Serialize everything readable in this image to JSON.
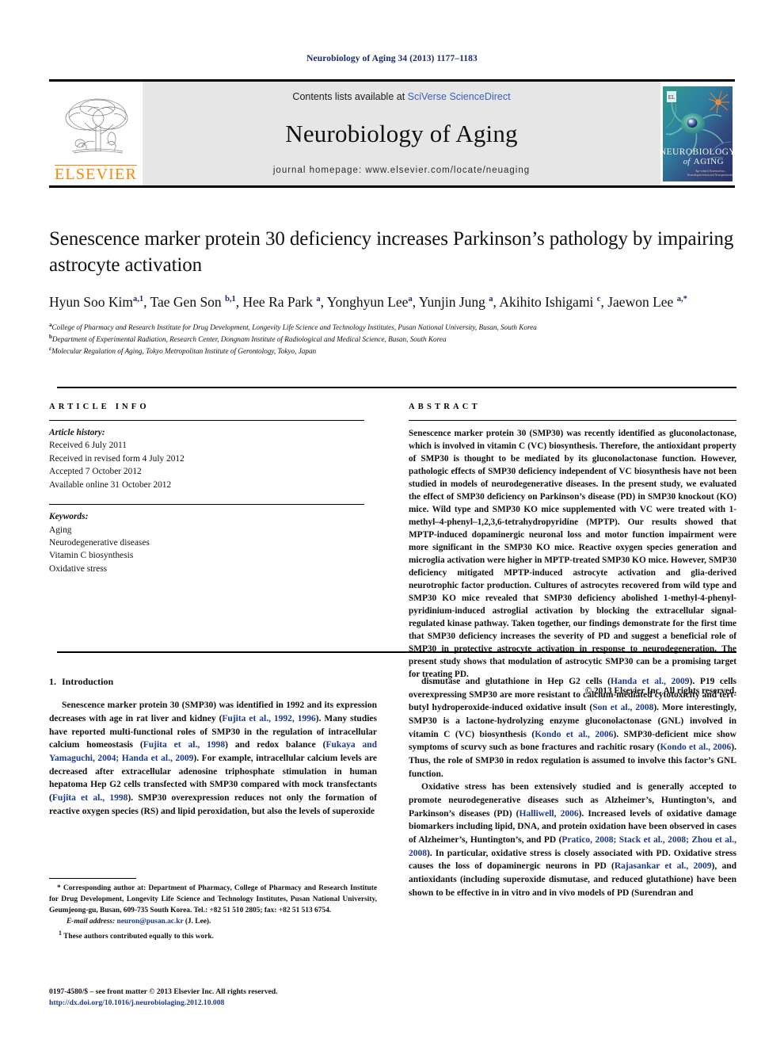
{
  "running_head": "Neurobiology of Aging 34 (2013) 1177–1183",
  "masthead": {
    "publisher_name": "ELSEVIER",
    "contents_prefix": "Contents lists available at ",
    "contents_link": "SciVerse ScienceDirect",
    "journal_title": "Neurobiology of Aging",
    "homepage": "journal homepage: www.elsevier.com/locate/neuaging",
    "cover_title_top": "NEUROBIOLOGY",
    "cover_title_mid": "of AGING",
    "cover_subtitle": "Age-related Neuroscience, Neurodegeneration and Neuroprotection"
  },
  "article": {
    "title": "Senescence marker protein 30 deficiency increases Parkinson’s pathology by impairing astrocyte activation",
    "authors_html": "Hyun Soo Kim<sup>a,1</sup>, Tae Gen Son <sup>b,1</sup>, Hee Ra Park <sup>a</sup>, Yonghyun Lee<sup>a</sup>, Yunjin Jung <sup>a</sup>, Akihito Ishigami <sup>c</sup>, Jaewon Lee <sup>a,*</sup>",
    "affiliations": [
      "College of Pharmacy and Research Institute for Drug Development, Longevity Life Science and Technology Institutes, Pusan National University, Busan, South Korea",
      "Department of Experimental Radiation, Research Center, Dongnam Institute of Radiological and Medical Science, Busan, South Korea",
      "Molecular Regulation of Aging, Tokyo Metropolitan Institute of Gerontology, Tokyo, Japan"
    ],
    "affiliation_marks": [
      "a",
      "b",
      "c"
    ]
  },
  "info": {
    "heading": "ARTICLE INFO",
    "history_label": "Article history:",
    "history": [
      "Received 6 July 2011",
      "Received in revised form 4 July 2012",
      "Accepted 7 October 2012",
      "Available online 31 October 2012"
    ],
    "keywords_label": "Keywords:",
    "keywords": [
      "Aging",
      "Neurodegenerative diseases",
      "Vitamin C biosynthesis",
      "Oxidative stress"
    ]
  },
  "abstract": {
    "heading": "ABSTRACT",
    "text": "Senescence marker protein 30 (SMP30) was recently identified as gluconolactonase, which is involved in vitamin C (VC) biosynthesis. Therefore, the antioxidant property of SMP30 is thought to be mediated by its gluconolactonase function. However, pathologic effects of SMP30 deficiency independent of VC biosynthesis have not been studied in models of neurodegenerative diseases. In the present study, we evaluated the effect of SMP30 deficiency on Parkinson’s disease (PD) in SMP30 knockout (KO) mice. Wild type and SMP30 KO mice supplemented with VC were treated with 1-methyl–4-phenyl–1,2,3,6-tetrahydropyridine (MPTP). Our results showed that MPTP-induced dopaminergic neuronal loss and motor function impairment were more significant in the SMP30 KO mice. Reactive oxygen species generation and microglia activation were higher in MPTP-treated SMP30 KO mice. However, SMP30 deficiency mitigated MPTP-induced astrocyte activation and glia-derived neurotrophic factor production. Cultures of astrocytes recovered from wild type and SMP30 KO mice revealed that SMP30 deficiency abolished 1-methyl-4-phenyl-pyridinium-induced astroglial activation by blocking the extracellular signal-regulated kinase pathway. Taken together, our findings demonstrate for the first time that SMP30 deficiency increases the severity of PD and suggest a beneficial role of SMP30 in protective astrocyte activation in response to neurodegeneration. The present study shows that modulation of astrocytic SMP30 can be a promising target for treating PD.",
    "copyright": "© 2013 Elsevier Inc. All rights reserved."
  },
  "body": {
    "section_number": "1.",
    "section_title": "Introduction",
    "left_paragraphs": [
      "Senescence marker protein 30 (SMP30) was identified in 1992 and its expression decreases with age in rat liver and kidney (Fujita et al., 1992, 1996). Many studies have reported multi-functional roles of SMP30 in the regulation of intracellular calcium homeostasis (Fujita et al., 1998) and redox balance (Fukaya and Yamaguchi, 2004; Handa et al., 2009). For example, intracellular calcium levels are decreased after extracellular adenosine triphosphate stimulation in human hepatoma Hep G2 cells transfected with SMP30 compared with mock transfectants (Fujita et al., 1998). SMP30 overexpression reduces not only the formation of reactive oxygen species (RS) and lipid peroxidation, but also the levels of superoxide"
    ],
    "right_paragraphs": [
      "dismutase and glutathione in Hep G2 cells (Handa et al., 2009). P19 cells overexpressing SMP30 are more resistant to calcium-mediated cytotoxicity and tert-butyl hydroperoxide-induced oxidative insult (Son et al., 2008). More interestingly, SMP30 is a lactone-hydrolyzing enzyme gluconolactonase (GNL) involved in vitamin C (VC) biosynthesis (Kondo et al., 2006). SMP30-deficient mice show symptoms of scurvy such as bone fractures and rachitic rosary (Kondo et al., 2006). Thus, the role of SMP30 in redox regulation is assumed to involve this factor’s GNL function.",
      "Oxidative stress has been extensively studied and is generally accepted to promote neurodegenerative diseases such as Alzheimer’s, Huntington’s, and Parkinson’s diseases (PD) (Halliwell, 2006). Increased levels of oxidative damage biomarkers including lipid, DNA, and protein oxidation have been observed in cases of Alzheimer’s, Huntington’s, and PD (Pratico, 2008; Stack et al., 2008; Zhou et al., 2008). In particular, oxidative stress is closely associated with PD. Oxidative stress causes the loss of dopaminergic neurons in PD (Rajasankar et al., 2009), and antioxidants (including superoxide dismutase, and reduced glutathione) have been shown to be effective in in vitro and in vivo models of PD (Surendran and"
    ]
  },
  "footnotes": {
    "corresponding": "* Corresponding author at: Department of Pharmacy, College of Pharmacy and Research Institute for Drug Development, Longevity Life Science and Technology Institutes, Pusan National University, Geumjeong-gu, Busan, 609-735 South Korea. Tel.: +82 51 510 2805; fax: +82 51 513 6754.",
    "email_label": "E-mail address:",
    "email_address": "neuron@pusan.ac.kr",
    "email_suffix": "(J. Lee).",
    "equal_marker": "1",
    "equal_contribution": "These authors contributed equally to this work."
  },
  "footer": {
    "issn_line": "0197-4580/$ – see front matter © 2013 Elsevier Inc. All rights reserved.",
    "doi": "http://dx.doi.org/10.1016/j.neurobiolaging.2012.10.008"
  },
  "colors": {
    "link_blue": "#1b3a8c",
    "elsevier_orange": "#ff8200",
    "masthead_gray": "#e6e6e6",
    "running_head_navy": "#1b2a6b"
  }
}
